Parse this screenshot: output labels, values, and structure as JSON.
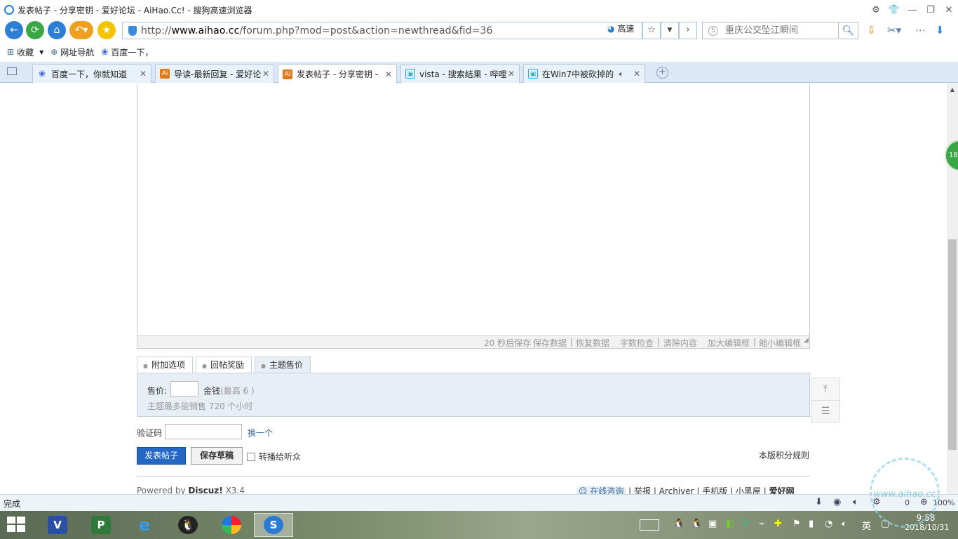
{
  "window": {
    "title": "发表帖子 - 分享密钥 - 爱好论坛 - AiHao.Cc! - 搜狗高速浏览器"
  },
  "navbar": {
    "url_prefix": "http://",
    "url_domain": "www.aihao.cc",
    "url_path": "/forum.php?mod=post&action=newthread&fid=36",
    "speed_label": "高速",
    "search_placeholder": "重庆公交坠江瞬间"
  },
  "bookmarks": [
    {
      "label": "收藏"
    },
    {
      "label": "网址导航"
    },
    {
      "label": "百度一下，"
    }
  ],
  "tabs": [
    {
      "label": "百度一下，你就知道",
      "icon": "baidu-paw-icon"
    },
    {
      "label": "导读-最新回复 - 爱好论",
      "icon": "aihao-logo-icon"
    },
    {
      "label": "发表帖子 - 分享密钥 -",
      "icon": "aihao-logo-icon",
      "active": true
    },
    {
      "label": "vista - 搜索结果 - 哔哩",
      "icon": "bilibili-icon"
    },
    {
      "label": "在Win7中被砍掉的",
      "icon": "bilibili-icon"
    }
  ],
  "editor": {
    "autosave": "20 秒后保存",
    "save_data": "保存数据",
    "restore_data": "恢复数据",
    "word_check": "字数检查",
    "clear": "清除内容",
    "enlarge": "加大编辑框",
    "shrink": "缩小编辑框"
  },
  "options": {
    "tabs": [
      "附加选项",
      "回帖奖励",
      "主题售价"
    ],
    "price_label": "售价:",
    "price_value": "",
    "unit": "金钱",
    "max": "(最高 6 )",
    "hint": "主题最多能销售 720 个小时"
  },
  "captcha": {
    "label": "验证码",
    "value": "",
    "change": "换一个"
  },
  "actions": {
    "post": "发表帖子",
    "draft": "保存草稿",
    "relay": "转播给听众",
    "rules": "本版积分规则"
  },
  "footer": {
    "powered": "Powered by",
    "brand": "Discuz!",
    "version": "X3.4",
    "links": [
      "在线咨询",
      "举报",
      "Archiver",
      "手机版",
      "小黑屋",
      "爱好网"
    ]
  },
  "side_badge": "18",
  "statusbar": {
    "text": "完成",
    "zoom": "100%",
    "count": "0"
  },
  "taskbar": {
    "time": "9:58",
    "date": "2018/10/31",
    "ime": "英"
  },
  "watermark": "www.aihao.cc"
}
